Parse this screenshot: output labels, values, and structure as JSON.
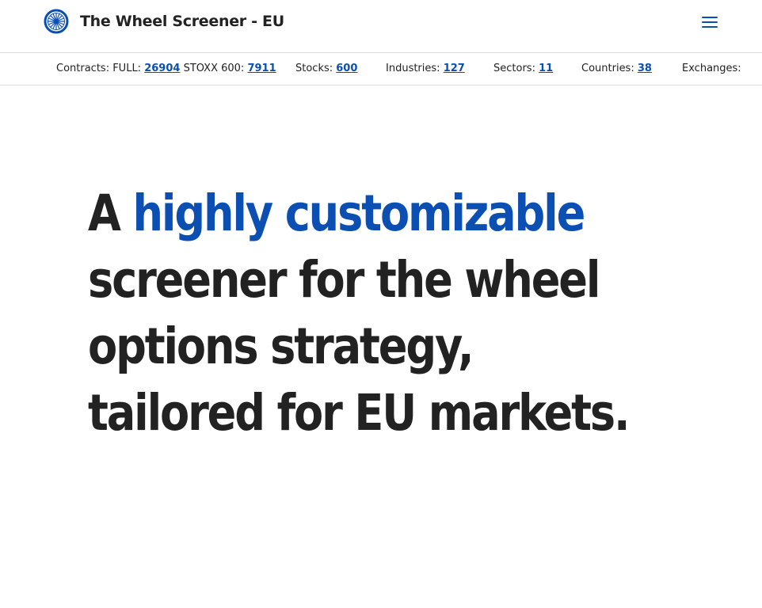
{
  "brand": {
    "title": "The Wheel Screener - EU",
    "logo_icon": "wheel-icon",
    "accent_color": "#0b4fb3"
  },
  "header": {
    "menu_icon": "hamburger-menu-icon"
  },
  "stats": {
    "contracts_label": "Contracts: FULL: ",
    "contracts_full": "26904",
    "stoxx_label": " STOXX 600: ",
    "stoxx_value": "7911",
    "stocks_label": "Stocks: ",
    "stocks_value": "600",
    "industries_label": "Industries: ",
    "industries_value": "127",
    "sectors_label": "Sectors: ",
    "sectors_value": "11",
    "countries_label": "Countries: ",
    "countries_value": "38",
    "exchanges_label": "Exchanges:"
  },
  "hero": {
    "prefix": "A ",
    "highlight": "highly customizable",
    "line2": "screener for the wheel",
    "line3": "options strategy,",
    "line4": "tailored for EU markets."
  }
}
